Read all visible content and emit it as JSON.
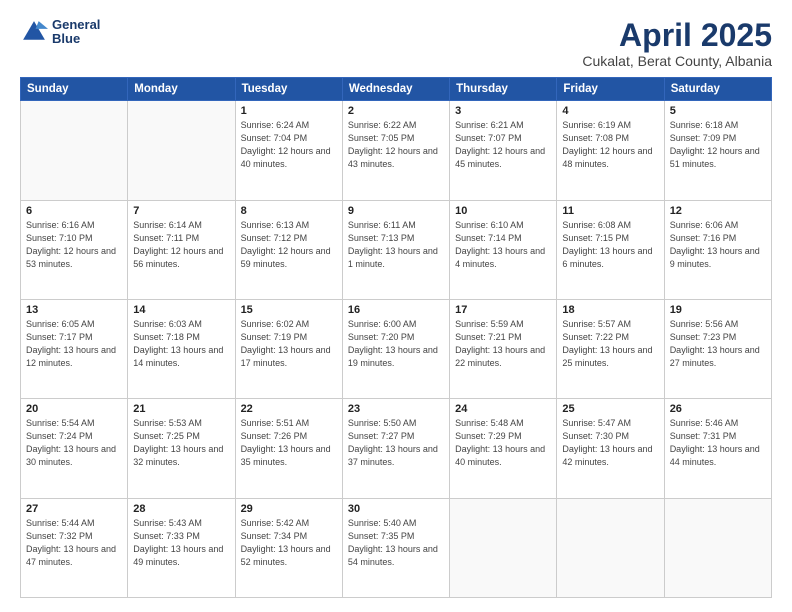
{
  "logo": {
    "line1": "General",
    "line2": "Blue"
  },
  "title": "April 2025",
  "subtitle": "Cukalat, Berat County, Albania",
  "headers": [
    "Sunday",
    "Monday",
    "Tuesday",
    "Wednesday",
    "Thursday",
    "Friday",
    "Saturday"
  ],
  "weeks": [
    [
      {
        "day": "",
        "empty": true
      },
      {
        "day": "",
        "empty": true
      },
      {
        "day": "1",
        "sunrise": "6:24 AM",
        "sunset": "7:04 PM",
        "daylight": "12 hours and 40 minutes."
      },
      {
        "day": "2",
        "sunrise": "6:22 AM",
        "sunset": "7:05 PM",
        "daylight": "12 hours and 43 minutes."
      },
      {
        "day": "3",
        "sunrise": "6:21 AM",
        "sunset": "7:07 PM",
        "daylight": "12 hours and 45 minutes."
      },
      {
        "day": "4",
        "sunrise": "6:19 AM",
        "sunset": "7:08 PM",
        "daylight": "12 hours and 48 minutes."
      },
      {
        "day": "5",
        "sunrise": "6:18 AM",
        "sunset": "7:09 PM",
        "daylight": "12 hours and 51 minutes."
      }
    ],
    [
      {
        "day": "6",
        "sunrise": "6:16 AM",
        "sunset": "7:10 PM",
        "daylight": "12 hours and 53 minutes."
      },
      {
        "day": "7",
        "sunrise": "6:14 AM",
        "sunset": "7:11 PM",
        "daylight": "12 hours and 56 minutes."
      },
      {
        "day": "8",
        "sunrise": "6:13 AM",
        "sunset": "7:12 PM",
        "daylight": "12 hours and 59 minutes."
      },
      {
        "day": "9",
        "sunrise": "6:11 AM",
        "sunset": "7:13 PM",
        "daylight": "13 hours and 1 minute."
      },
      {
        "day": "10",
        "sunrise": "6:10 AM",
        "sunset": "7:14 PM",
        "daylight": "13 hours and 4 minutes."
      },
      {
        "day": "11",
        "sunrise": "6:08 AM",
        "sunset": "7:15 PM",
        "daylight": "13 hours and 6 minutes."
      },
      {
        "day": "12",
        "sunrise": "6:06 AM",
        "sunset": "7:16 PM",
        "daylight": "13 hours and 9 minutes."
      }
    ],
    [
      {
        "day": "13",
        "sunrise": "6:05 AM",
        "sunset": "7:17 PM",
        "daylight": "13 hours and 12 minutes."
      },
      {
        "day": "14",
        "sunrise": "6:03 AM",
        "sunset": "7:18 PM",
        "daylight": "13 hours and 14 minutes."
      },
      {
        "day": "15",
        "sunrise": "6:02 AM",
        "sunset": "7:19 PM",
        "daylight": "13 hours and 17 minutes."
      },
      {
        "day": "16",
        "sunrise": "6:00 AM",
        "sunset": "7:20 PM",
        "daylight": "13 hours and 19 minutes."
      },
      {
        "day": "17",
        "sunrise": "5:59 AM",
        "sunset": "7:21 PM",
        "daylight": "13 hours and 22 minutes."
      },
      {
        "day": "18",
        "sunrise": "5:57 AM",
        "sunset": "7:22 PM",
        "daylight": "13 hours and 25 minutes."
      },
      {
        "day": "19",
        "sunrise": "5:56 AM",
        "sunset": "7:23 PM",
        "daylight": "13 hours and 27 minutes."
      }
    ],
    [
      {
        "day": "20",
        "sunrise": "5:54 AM",
        "sunset": "7:24 PM",
        "daylight": "13 hours and 30 minutes."
      },
      {
        "day": "21",
        "sunrise": "5:53 AM",
        "sunset": "7:25 PM",
        "daylight": "13 hours and 32 minutes."
      },
      {
        "day": "22",
        "sunrise": "5:51 AM",
        "sunset": "7:26 PM",
        "daylight": "13 hours and 35 minutes."
      },
      {
        "day": "23",
        "sunrise": "5:50 AM",
        "sunset": "7:27 PM",
        "daylight": "13 hours and 37 minutes."
      },
      {
        "day": "24",
        "sunrise": "5:48 AM",
        "sunset": "7:29 PM",
        "daylight": "13 hours and 40 minutes."
      },
      {
        "day": "25",
        "sunrise": "5:47 AM",
        "sunset": "7:30 PM",
        "daylight": "13 hours and 42 minutes."
      },
      {
        "day": "26",
        "sunrise": "5:46 AM",
        "sunset": "7:31 PM",
        "daylight": "13 hours and 44 minutes."
      }
    ],
    [
      {
        "day": "27",
        "sunrise": "5:44 AM",
        "sunset": "7:32 PM",
        "daylight": "13 hours and 47 minutes."
      },
      {
        "day": "28",
        "sunrise": "5:43 AM",
        "sunset": "7:33 PM",
        "daylight": "13 hours and 49 minutes."
      },
      {
        "day": "29",
        "sunrise": "5:42 AM",
        "sunset": "7:34 PM",
        "daylight": "13 hours and 52 minutes."
      },
      {
        "day": "30",
        "sunrise": "5:40 AM",
        "sunset": "7:35 PM",
        "daylight": "13 hours and 54 minutes."
      },
      {
        "day": "",
        "empty": true
      },
      {
        "day": "",
        "empty": true
      },
      {
        "day": "",
        "empty": true
      }
    ]
  ]
}
